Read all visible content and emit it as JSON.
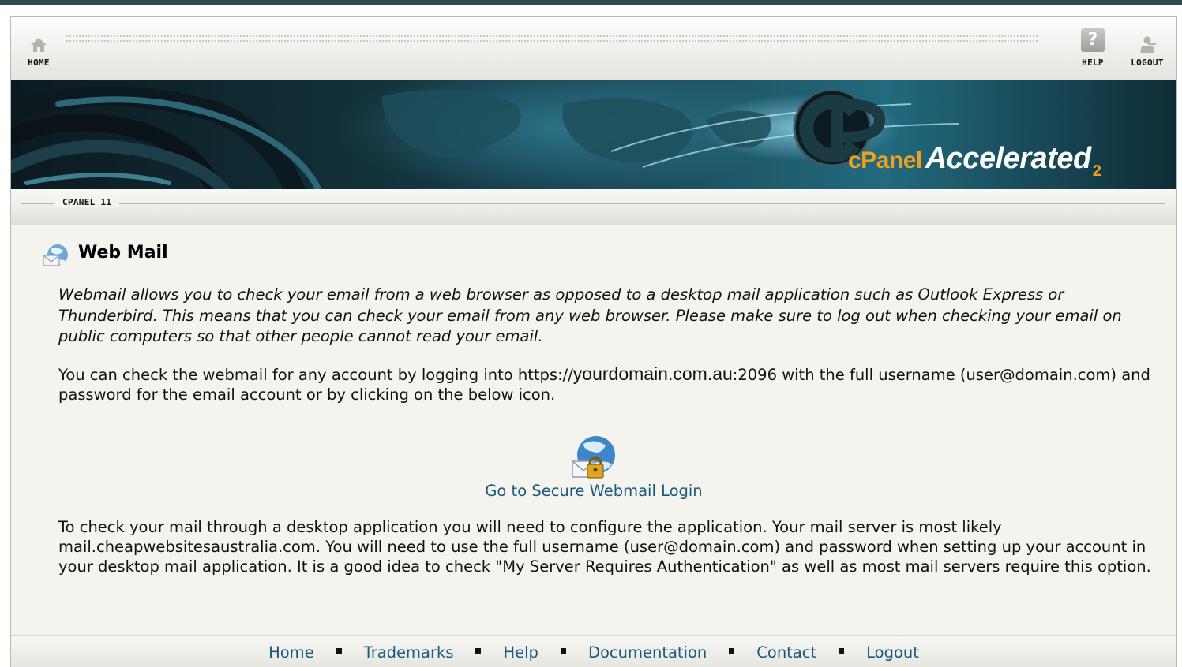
{
  "topnav": {
    "home_label": "HOME",
    "help_label": "HELP",
    "logout_label": "LOGOUT",
    "help_icon_glyph": "?"
  },
  "banner": {
    "brand_cpanel": "cPanel",
    "brand_accelerated": "Accelerated",
    "brand_version": "2"
  },
  "section": {
    "label": "CPANEL 11"
  },
  "main": {
    "title": "Web Mail",
    "intro": "Webmail allows you to check your email from a web browser as opposed to a desktop mail application such as Outlook Express or Thunderbird. This means that you can check your email from any web browser. Please make sure to log out when checking your email on public computers so that other people cannot read your email.",
    "access_before": "You can check the webmail for any account by logging into https://",
    "access_domain": "yourdomain.com.au",
    "access_after": ":2096 with the full username (user@domain.com) and password for the email account or by clicking on the below icon.",
    "webmail_link": "Go to Secure Webmail Login",
    "desktop_text": "To check your mail through a desktop application you will need to configure the application. Your mail server is most likely mail.cheapwebsitesaustralia.com. You will need to use the full username (user@domain.com) and password when setting up your account in your desktop mail application. It is a good idea to check \"My Server Requires Authentication\" as well as most mail servers require this option."
  },
  "footer": {
    "links": [
      "Home",
      "Trademarks",
      "Help",
      "Documentation",
      "Contact",
      "Logout"
    ]
  },
  "colors": {
    "frame_top": "#2f4b4f",
    "page_bg": "#f4f3ee",
    "link": "#1a5a7a",
    "brand_orange": "#f0a020"
  }
}
